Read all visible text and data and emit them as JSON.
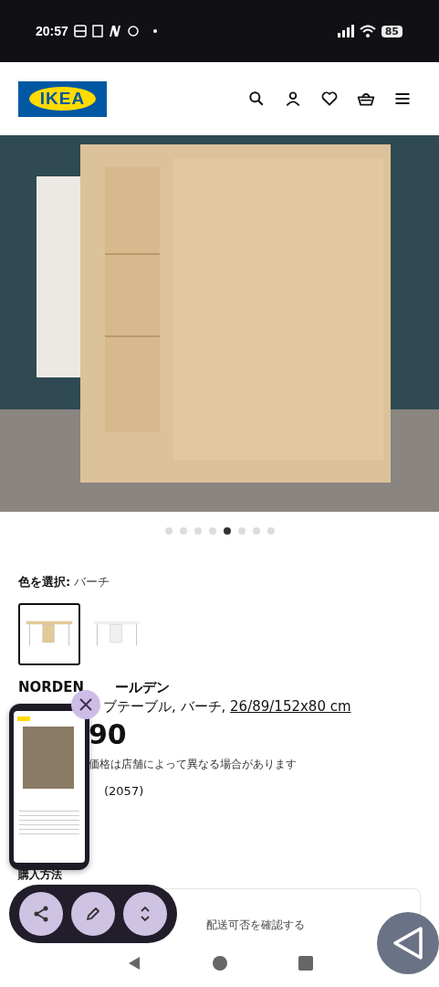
{
  "status_bar": {
    "time": "20:57",
    "battery": "85"
  },
  "header": {
    "logo": "IKEA"
  },
  "carousel": {
    "dots": [
      {
        "selected": false
      },
      {
        "selected": false
      },
      {
        "selected": false
      },
      {
        "selected": false
      },
      {
        "selected": true
      },
      {
        "selected": false
      },
      {
        "selected": false
      },
      {
        "selected": false
      }
    ]
  },
  "color_picker": {
    "label": "色を選択:",
    "value": "バーチ",
    "swatches": [
      {
        "kind": "birch",
        "selected": true
      },
      {
        "kind": "white",
        "selected": false
      }
    ]
  },
  "product": {
    "name": "NORDEN",
    "name_rest": "ールデン",
    "description": "ブテーブル, バーチ, ",
    "size_link": "26/89/152x80 cm",
    "price": "90",
    "price_note": "価格は店舗によって異なる場合があります",
    "review_count": "(2057)"
  },
  "purchase": {
    "heading": "購入方法",
    "option": "配送可否を確認する"
  }
}
